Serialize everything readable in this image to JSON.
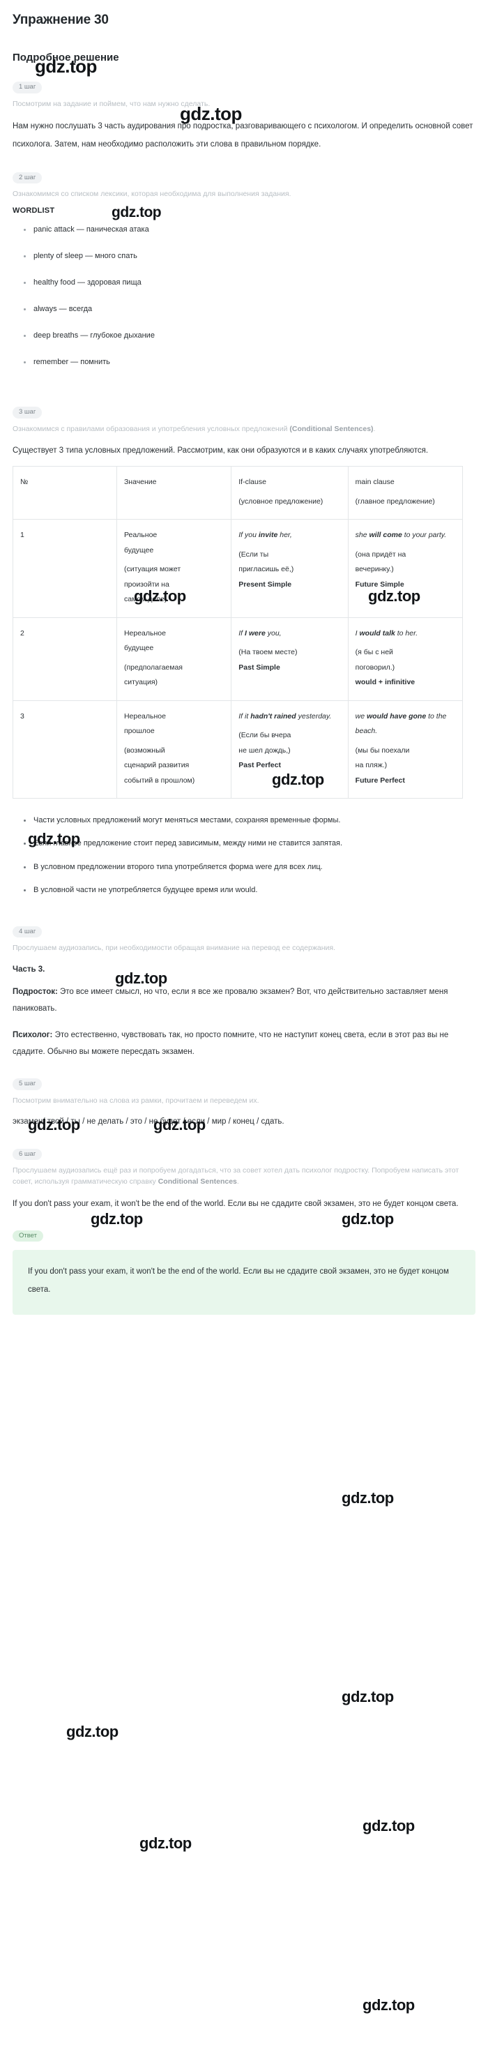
{
  "exercise": {
    "title": "Упражнение 30"
  },
  "solution": {
    "heading": "Подробное решение"
  },
  "watermark": {
    "text": "gdz.top"
  },
  "steps": {
    "s1": {
      "badge": "1 шаг",
      "hint": "Посмотрим на задание и поймем, что нам нужно сделать.",
      "body": "Нам нужно послушать 3 часть аудирования про подростка, разговаривающего с психологом. И определить основной совет психолога. Затем, нам необходимо расположить эти слова в правильном порядке."
    },
    "s2": {
      "badge": "2 шаг",
      "hint": "Ознакомимся со списком лексики, которая необходима для выполнения задания.",
      "wordlist_title": "WORDLIST",
      "words": [
        "panic attack — паническая атака",
        "plenty of sleep — много спать",
        "healthy food — здоровая пища",
        "always — всегда",
        "deep breaths — глубокое дыхание",
        "remember — помнить"
      ]
    },
    "s3": {
      "badge": "3 шаг",
      "hint_part1": "Ознакомимся с правилами образования и употребления условных предложений ",
      "hint_bold": "(Conditional Sentences)",
      "hint_part2": ".",
      "body": "Существует 3 типа условных предложений. Рассмотрим, как они образуются и в каких случаях употребляются.",
      "notes": [
        "Части условных предложений могут меняться местами, сохраняя временные формы.",
        "Если главное предложение стоит перед зависимым, между ними не ставится запятая.",
        "В условном предложении второго типа употребляется форма were для всех лиц.",
        "В условной части не употребляется будущее время или would."
      ]
    },
    "s4": {
      "badge": "4 шаг",
      "hint": "Прослушаем аудиозапись, при необходимости обращая внимание на перевод ее содержания.",
      "part_title": "Часть 3.",
      "lines": [
        {
          "speaker": "Подросток:",
          "text": " Это все имеет смысл, но что, если я все же провалю экзамен? Вот, что действительно заставляет меня паниковать."
        },
        {
          "speaker": "Психолог:",
          "text": " Это естественно, чувствовать так, но просто помните, что не наступит конец света, если в этот раз вы не сдадите. Обычно вы можете пересдать экзамен."
        }
      ]
    },
    "s5": {
      "badge": "5 шаг",
      "hint": "Посмотрим внимательно на слова из рамки, прочитаем и переведем их.",
      "words_line": "экзамен/ твой / ты / не делать / это / не будет / если / мир / конец / сдать."
    },
    "s6": {
      "badge": "6 шаг",
      "hint_part1": "Прослушаем аудиозапись ещё раз и попробуем догадаться, что за совет хотел дать психолог подростку. Попробуем написать этот совет, используя грамматическую справку ",
      "hint_bold": "Conditional Sentences",
      "hint_part2": ".",
      "body": "If you don't pass your exam, it won't be the end of the world. Если вы не сдадите свой экзамен, это не будет концом света."
    }
  },
  "table": {
    "headers": {
      "num": "№",
      "meaning": "Значение",
      "if_clause_en": "If-clause",
      "if_clause_ru": "(условное предложение)",
      "main_clause_en": "main clause",
      "main_clause_ru": "(главное предложение)"
    },
    "rows": [
      {
        "num": "1",
        "meaning_title_1": "Реальное",
        "meaning_title_2": "будущее",
        "meaning_note_1": "(ситуация может",
        "meaning_note_2": "произойти на",
        "meaning_note_3": "самом деле)",
        "if_en_a": "If you ",
        "if_en_b": "invite",
        "if_en_c": " her,",
        "if_ru_1": "(Если ты",
        "if_ru_2": "пригласишь её,)",
        "if_tense": "Present Simple",
        "main_en_a": "she ",
        "main_en_b": "will come",
        "main_en_c": " to your party.",
        "main_ru_1": "(она придёт на",
        "main_ru_2": "вечеринку.)",
        "main_tense": "Future Simple"
      },
      {
        "num": "2",
        "meaning_title_1": "Нереальное",
        "meaning_title_2": "будущее",
        "meaning_note_1": "(предполагаемая",
        "meaning_note_2": "ситуация)",
        "meaning_note_3": "",
        "if_en_a": "If ",
        "if_en_b": "I were",
        "if_en_c": " you,",
        "if_ru_1": "(На твоем месте)",
        "if_ru_2": "",
        "if_tense": "Past Simple",
        "main_en_a": "I ",
        "main_en_b": "would talk",
        "main_en_c": " to her.",
        "main_ru_1": "(я бы с ней",
        "main_ru_2": "поговорил.)",
        "main_tense": "would + infinitive"
      },
      {
        "num": "3",
        "meaning_title_1": "Нереальное",
        "meaning_title_2": "прошлое",
        "meaning_note_1": "(возможный",
        "meaning_note_2": "сценарий развития",
        "meaning_note_3": "событий в прошлом)",
        "if_en_a": "If it ",
        "if_en_b": "hadn't rained",
        "if_en_c": " yesterday.",
        "if_ru_1": "(Если бы вчера",
        "if_ru_2": "не шел дождь,)",
        "if_tense": "Past Perfect",
        "main_en_a": "we ",
        "main_en_b": "would have gone",
        "main_en_c": " to the beach.",
        "main_ru_1": "(мы бы поехали",
        "main_ru_2": "на пляж.)",
        "main_tense": "Future Perfect"
      }
    ]
  },
  "answer": {
    "badge": "Ответ",
    "text": "If you don't pass your exam, it won't be the end of the world. Если вы не сдадите свой экзамен, это не будет концом света."
  }
}
